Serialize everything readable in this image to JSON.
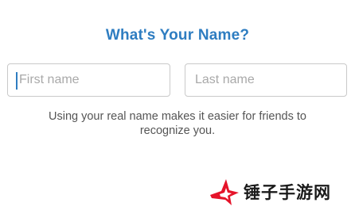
{
  "header": {
    "title": "What's Your Name?"
  },
  "form": {
    "first_name": {
      "value": "",
      "placeholder": "First name"
    },
    "last_name": {
      "value": "",
      "placeholder": "Last name"
    },
    "helper_text": "Using your real name makes it easier for friends to recognize you."
  },
  "watermark": {
    "text": "锤子手游网",
    "icon": "star-logo-icon"
  },
  "colors": {
    "title": "#2e7dc1",
    "border": "#c9c9c9",
    "placeholder": "#a9a9a9",
    "helper": "#555555",
    "logo_red": "#e5142a"
  }
}
